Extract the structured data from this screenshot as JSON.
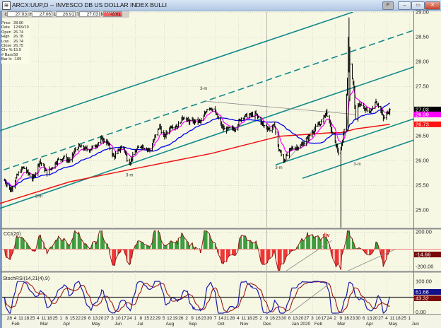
{
  "window": {
    "title": "ARCX:UUP,D -- INVESCO DB US DOLLAR INDEX BULLI",
    "buttons": {
      "f_label": "F",
      "minimize": "–",
      "restore": "▭",
      "close": "✕"
    }
  },
  "quote_bar": {
    "fields": [
      {
        "label": "G",
        "value": "27.03"
      },
      {
        "label": "H",
        "value": "27.06"
      },
      {
        "label": "L",
        "value": "26.91"
      },
      {
        "label": "T",
        "value": "27.03"
      },
      {
        "label": "N",
        "value": "-0.01",
        "negative": true
      }
    ]
  },
  "info_box": [
    {
      "label": "Price",
      "value": "28.90"
    },
    {
      "label": "Date",
      "value": "12/09/19"
    },
    {
      "label": "Open",
      "value": "26.74"
    },
    {
      "label": "High",
      "value": "26.78"
    },
    {
      "label": "Low",
      "value": "26.74"
    },
    {
      "label": "Close",
      "value": "26.75"
    },
    {
      "label": "Chr %",
      "value": "15.9"
    },
    {
      "label": "# Bars",
      "value": "58"
    },
    {
      "label": "Bar Ix",
      "value": "-109"
    }
  ],
  "colors": {
    "background": "#f7f8e4",
    "bars": "#000000",
    "ema_fast": "#ff00ff",
    "ma_mid": "#0000ee",
    "ma_slow": "#ee1111",
    "channel": "#138a8a",
    "trendline": "#888888",
    "cci_pos": "#3a9a3a",
    "cci_neg": "#ee3333",
    "stoch_k": "#1a1aa8",
    "stoch_d": "#a01818"
  },
  "chart_data": [
    {
      "type": "line",
      "title": "ARCX:UUP,D",
      "description_kind": "ohlc-daily",
      "ylim": [
        24.8,
        29.0
      ],
      "y_ticks": [
        "29.00",
        "28.50",
        "28.00",
        "27.50",
        "27.00",
        "26.50",
        "26.00",
        "25.50",
        "25.00"
      ],
      "grid": true,
      "close_path": [
        [
          "2019-01-22",
          25.6
        ],
        [
          "2019-01-29",
          25.39
        ],
        [
          "2019-02-08",
          25.74
        ],
        [
          "2019-02-14",
          25.86
        ],
        [
          "2019-02-20",
          25.74
        ],
        [
          "2019-02-26",
          25.63
        ],
        [
          "2019-03-06",
          25.99
        ],
        [
          "2019-03-15",
          25.74
        ],
        [
          "2019-03-27",
          25.99
        ],
        [
          "2019-04-04",
          26.06
        ],
        [
          "2019-04-12",
          25.99
        ],
        [
          "2019-04-21",
          26.29
        ],
        [
          "2019-05-05",
          26.21
        ],
        [
          "2019-05-14",
          26.31
        ],
        [
          "2019-05-21",
          26.43
        ],
        [
          "2019-05-28",
          26.36
        ],
        [
          "2019-06-05",
          26.07
        ],
        [
          "2019-06-16",
          26.31
        ],
        [
          "2019-06-23",
          25.93
        ],
        [
          "2019-07-01",
          26.17
        ],
        [
          "2019-07-08",
          26.31
        ],
        [
          "2019-07-19",
          26.21
        ],
        [
          "2019-07-25",
          26.46
        ],
        [
          "2019-07-31",
          26.7
        ],
        [
          "2019-08-05",
          26.46
        ],
        [
          "2019-08-14",
          26.7
        ],
        [
          "2019-08-22",
          26.7
        ],
        [
          "2019-08-29",
          26.89
        ],
        [
          "2019-09-04",
          26.79
        ],
        [
          "2019-09-21",
          26.79
        ],
        [
          "2019-09-28",
          27.1
        ],
        [
          "2019-10-05",
          27.03
        ],
        [
          "2019-10-17",
          26.63
        ],
        [
          "2019-10-31",
          26.64
        ],
        [
          "2019-11-09",
          26.89
        ],
        [
          "2019-11-26",
          26.93
        ],
        [
          "2019-12-05",
          26.71
        ],
        [
          "2019-12-13",
          26.63
        ],
        [
          "2019-12-19",
          26.71
        ],
        [
          "2019-12-22",
          26.31
        ],
        [
          "2019-12-30",
          25.99
        ],
        [
          "2020-01-08",
          26.24
        ],
        [
          "2020-01-20",
          26.29
        ],
        [
          "2020-01-29",
          26.46
        ],
        [
          "2020-02-06",
          26.64
        ],
        [
          "2020-02-15",
          26.79
        ],
        [
          "2020-02-20",
          26.99
        ],
        [
          "2020-02-29",
          26.46
        ],
        [
          "2020-03-08",
          26.07
        ],
        [
          "2020-03-13",
          26.64
        ],
        [
          "2020-03-19",
          28.07
        ],
        [
          "2020-03-25",
          27.46
        ],
        [
          "2020-03-27",
          26.79
        ],
        [
          "2020-03-31",
          27.17
        ],
        [
          "2020-04-06",
          27.03
        ],
        [
          "2020-04-15",
          26.99
        ],
        [
          "2020-04-20",
          27.21
        ],
        [
          "2020-04-26",
          27.07
        ],
        [
          "2020-04-30",
          26.84
        ],
        [
          "2020-05-08",
          27.03
        ]
      ],
      "extremes": [
        {
          "date": "2020-03-19",
          "high": 28.89
        },
        {
          "date": "2020-03-09",
          "low": 24.6
        }
      ],
      "last": {
        "open": 27.03,
        "high": 27.06,
        "low": 26.91,
        "close": 27.03,
        "change": -0.01
      },
      "slow_ma": [
        [
          "2019-01-16",
          25.13
        ],
        [
          "2019-04-12",
          25.57
        ],
        [
          "2019-07-08",
          25.86
        ],
        [
          "2019-10-02",
          26.14
        ],
        [
          "2019-12-25",
          26.49
        ],
        [
          "2020-02-26",
          26.56
        ],
        [
          "2020-03-09",
          26.56
        ],
        [
          "2020-03-28",
          26.64
        ],
        [
          "2020-05-08",
          26.73
        ]
      ],
      "price_badges": [
        {
          "value": "27.03",
          "price": 27.03,
          "color": "#000000"
        },
        {
          "value": "26.99",
          "price": 26.93,
          "color": "#ff00ff"
        },
        {
          "value": "26.73",
          "price": 26.73,
          "color": "#ff1111"
        }
      ],
      "channel_lines": [
        {
          "from": [
            "2019-01-16",
            26.6
          ],
          "to": [
            "2020-03-24",
            29.0
          ],
          "style": "solid"
        },
        {
          "from": [
            "2019-01-21",
            25.81
          ],
          "to": [
            "2020-06-06",
            28.63
          ],
          "style": "dashed"
        },
        {
          "from": [
            "2019-01-16",
            25.03
          ],
          "to": [
            "2020-06-06",
            27.89
          ],
          "style": "solid"
        },
        {
          "from": [
            "2019-12-20",
            25.91
          ],
          "to": [
            "2020-06-06",
            26.84
          ],
          "style": "solid"
        },
        {
          "from": [
            "2020-01-22",
            25.64
          ],
          "to": [
            "2020-06-06",
            26.41
          ],
          "style": "solid"
        }
      ],
      "trend_lines": [
        {
          "from": [
            "2019-09-24",
            27.2
          ],
          "to": [
            "2020-03-27",
            26.93
          ]
        },
        {
          "from": [
            "2020-01-01",
            25.96
          ],
          "to": [
            "2020-02-24",
            27.0
          ]
        }
      ],
      "annotations": [
        {
          "text": "3-m",
          "date": "2019-03-05",
          "price": 25.25
        },
        {
          "text": "3-m",
          "date": "2019-06-24",
          "price": 25.68
        },
        {
          "text": "3-m",
          "date": "2019-09-23",
          "price": 27.43
        },
        {
          "text": "3-m",
          "date": "2019-12-24",
          "price": 25.83
        },
        {
          "text": "3-m",
          "date": "2020-03-29",
          "price": 25.9
        }
      ]
    },
    {
      "type": "area",
      "title": "CCI(20)",
      "ylim": [
        -240,
        240
      ],
      "y_ticks": [
        "200.00",
        "-200.00"
      ],
      "current": "-14.66",
      "annotation": {
        "text": "div",
        "date": "2020-02-20"
      },
      "trend_lines": [
        {
          "from": [
            "2019-12-30",
            -270
          ],
          "to": [
            "2020-02-27",
            100
          ]
        },
        {
          "from": [
            "2020-03-13",
            -270
          ],
          "to": [
            "2020-05-15",
            0
          ]
        }
      ]
    },
    {
      "type": "line",
      "title": "StochRSI(14,21(4),9)",
      "ylim": [
        0,
        100
      ],
      "y_ticks": [
        "100.00",
        "0.00"
      ],
      "reference_level": 50,
      "series": [
        {
          "name": "%K",
          "current": "61.68"
        },
        {
          "name": "%D",
          "current": "43.32"
        }
      ],
      "trend_lines": [
        {
          "from": [
            "2020-01-07",
            0
          ],
          "to": [
            "2020-02-24",
            93
          ]
        }
      ]
    }
  ],
  "date_axis": {
    "weeks": [
      {
        "month": "Feb",
        "days": [
          "2019-01-28",
          "2019-02-04",
          "2019-02-11",
          "2019-02-18",
          "2019-02-25"
        ]
      },
      {
        "month": "Mar",
        "days": [
          "2019-03-04",
          "2019-03-11",
          "2019-03-18",
          "2019-03-25"
        ]
      },
      {
        "month": "Apr",
        "days": [
          "2019-04-01",
          "2019-04-08",
          "2019-04-15",
          "2019-04-22",
          "2019-04-29"
        ]
      },
      {
        "month": "May",
        "days": [
          "2019-05-06",
          "2019-05-13",
          "2019-05-20",
          "2019-05-27"
        ]
      },
      {
        "month": "Jun",
        "days": [
          "2019-06-03",
          "2019-06-10",
          "2019-06-17",
          "2019-06-24"
        ]
      },
      {
        "month": "Jul",
        "days": [
          "2019-07-01",
          "2019-07-08",
          "2019-07-15",
          "2019-07-22",
          "2019-07-29"
        ]
      },
      {
        "month": "Aug",
        "days": [
          "2019-08-05",
          "2019-08-12",
          "2019-08-19",
          "2019-08-26"
        ]
      },
      {
        "month": "Sep",
        "days": [
          "2019-09-02",
          "2019-09-09",
          "2019-09-16",
          "2019-09-23",
          "2019-09-30"
        ]
      },
      {
        "month": "Oct",
        "days": [
          "2019-10-07",
          "2019-10-14",
          "2019-10-21",
          "2019-10-28"
        ]
      },
      {
        "month": "Nov",
        "days": [
          "2019-11-04",
          "2019-11-11",
          "2019-11-18",
          "2019-11-25"
        ]
      },
      {
        "month": "Dec",
        "days": [
          "2019-12-02",
          "2019-12-09",
          "2019-12-16",
          "2019-12-23",
          "2019-12-30"
        ]
      },
      {
        "month": "Jan 2020",
        "days": [
          "2020-01-06",
          "2020-01-13",
          "2020-01-20",
          "2020-01-27"
        ]
      },
      {
        "month": "Feb",
        "days": [
          "2020-02-03",
          "2020-02-10",
          "2020-02-17",
          "2020-02-24"
        ]
      },
      {
        "month": "Mar",
        "days": [
          "2020-03-02",
          "2020-03-09",
          "2020-03-16",
          "2020-03-23",
          "2020-03-30"
        ]
      },
      {
        "month": "Apr",
        "days": [
          "2020-04-06",
          "2020-04-13",
          "2020-04-20",
          "2020-04-27"
        ]
      },
      {
        "month": "May",
        "days": [
          "2020-05-04",
          "2020-05-11",
          "2020-05-18",
          "2020-05-25"
        ]
      },
      {
        "month": "Jun",
        "days": [
          "2020-06-01"
        ]
      }
    ]
  }
}
